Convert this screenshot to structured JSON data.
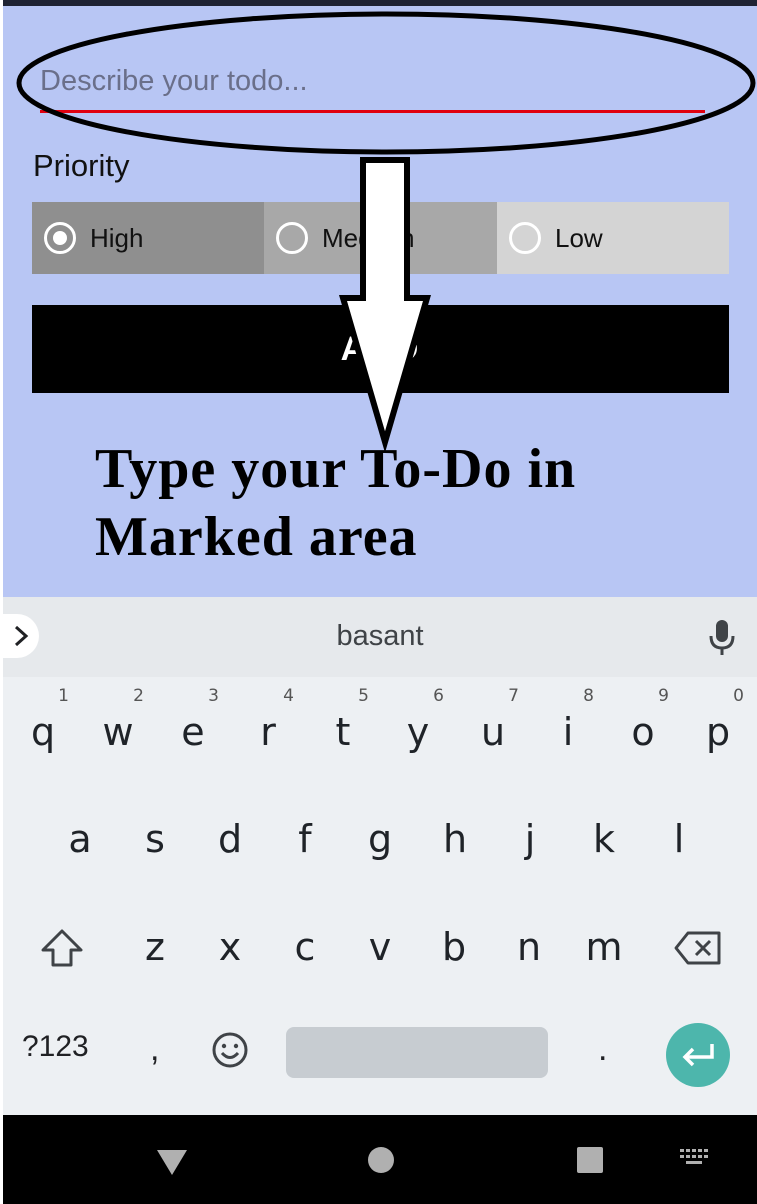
{
  "app": {
    "input_placeholder": "Describe your todo...",
    "priority_label": "Priority",
    "priorities": [
      {
        "label": "High",
        "selected": true
      },
      {
        "label": "Medium",
        "selected": false
      },
      {
        "label": "Low",
        "selected": false
      }
    ],
    "add_button_label": "ADD"
  },
  "annotation": {
    "line1": "Type your To-Do in",
    "line2": "Marked area"
  },
  "keyboard": {
    "suggestion": "basant",
    "row1": [
      {
        "key": "q",
        "num": "1"
      },
      {
        "key": "w",
        "num": "2"
      },
      {
        "key": "e",
        "num": "3"
      },
      {
        "key": "r",
        "num": "4"
      },
      {
        "key": "t",
        "num": "5"
      },
      {
        "key": "y",
        "num": "6"
      },
      {
        "key": "u",
        "num": "7"
      },
      {
        "key": "i",
        "num": "8"
      },
      {
        "key": "o",
        "num": "9"
      },
      {
        "key": "p",
        "num": "0"
      }
    ],
    "row2": [
      "a",
      "s",
      "d",
      "f",
      "g",
      "h",
      "j",
      "k",
      "l"
    ],
    "row3": [
      "z",
      "x",
      "c",
      "v",
      "b",
      "n",
      "m"
    ],
    "symbols_label": "?123",
    "comma_label": ",",
    "period_label": ".",
    "icons": {
      "expand": "chevron-right-icon",
      "mic": "microphone-icon",
      "shift": "shift-icon",
      "backspace": "backspace-icon",
      "emoji": "emoji-icon",
      "enter": "enter-icon"
    },
    "enter_color": "#4db6ac"
  },
  "navbar": {
    "icons": [
      "back-triangle-icon",
      "home-circle-icon",
      "recents-square-icon",
      "keyboard-switch-icon"
    ]
  },
  "colors": {
    "app_background": "#b8c6f4",
    "underline": "#e0000f",
    "add_button": "#000000"
  }
}
